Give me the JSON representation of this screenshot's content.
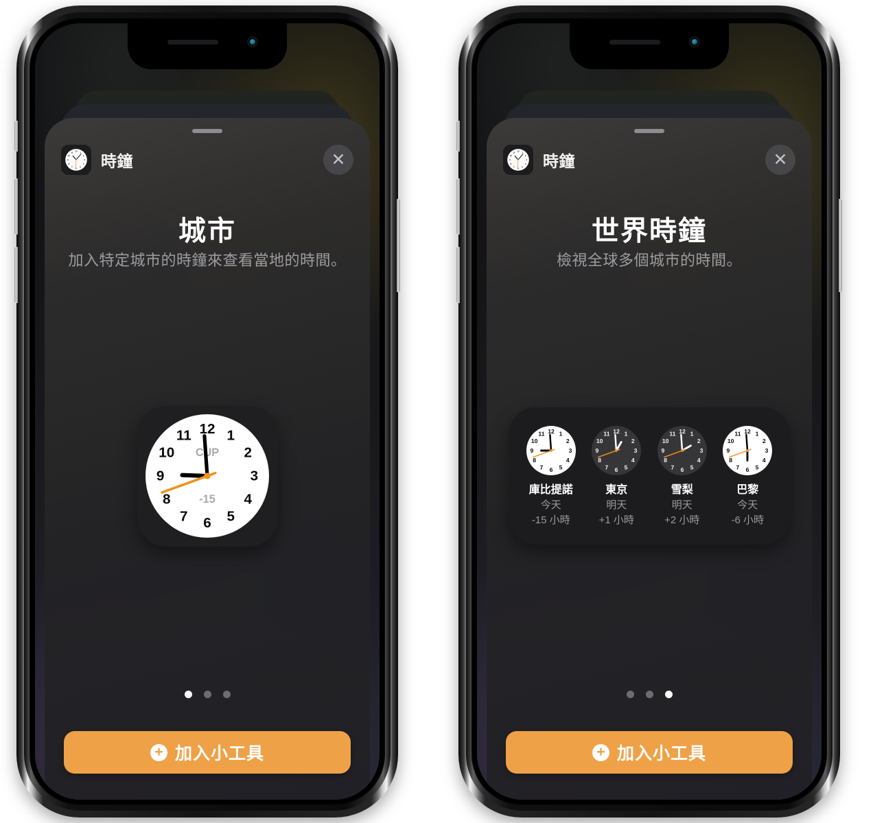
{
  "phones": [
    {
      "id": "left",
      "sheet": {
        "app_icon": "clock-icon",
        "app_name": "時鐘",
        "close_icon": "close-icon",
        "title": "城市",
        "subtitle": "加入特定城市的時鐘來查看當地的時間。"
      },
      "widget": {
        "type": "small-city-clock",
        "clock": {
          "label": "CUP",
          "offset": "-15",
          "theme": "light",
          "hour_deg": 272,
          "minute_deg": 356,
          "second_deg": 250
        }
      },
      "page_dots": {
        "count": 3,
        "active_index": 0
      },
      "add_button": {
        "icon": "plus-circle-icon",
        "label": "加入小工具"
      }
    },
    {
      "id": "right",
      "sheet": {
        "app_icon": "clock-icon",
        "app_name": "時鐘",
        "close_icon": "close-icon",
        "title": "世界時鐘",
        "subtitle": "檢視全球多個城市的時間。"
      },
      "widget": {
        "type": "medium-world-clock",
        "cities": [
          {
            "name": "庫比提諾",
            "day": "今天",
            "offset": "-15 小時",
            "theme": "light",
            "hour_deg": 270,
            "minute_deg": 356,
            "second_deg": 250
          },
          {
            "name": "東京",
            "day": "明天",
            "offset": "+1 小時",
            "theme": "dark",
            "hour_deg": 30,
            "minute_deg": 356,
            "second_deg": 250
          },
          {
            "name": "雪梨",
            "day": "明天",
            "offset": "+2 小時",
            "theme": "dark",
            "hour_deg": 60,
            "minute_deg": 356,
            "second_deg": 250
          },
          {
            "name": "巴黎",
            "day": "今天",
            "offset": "-6 小時",
            "theme": "light",
            "hour_deg": 180,
            "minute_deg": 356,
            "second_deg": 250
          }
        ]
      },
      "page_dots": {
        "count": 3,
        "active_index": 2
      },
      "add_button": {
        "icon": "plus-circle-icon",
        "label": "加入小工具"
      }
    }
  ],
  "colors": {
    "accent_orange": "#efa147",
    "second_hand_orange": "#f0921e",
    "sheet_background": "#2e2d2c",
    "active_dot": "#ffffff",
    "face_light": "#ffffff",
    "face_dark": "#363638"
  },
  "clock_numerals": [
    "12",
    "1",
    "2",
    "3",
    "4",
    "5",
    "6",
    "7",
    "8",
    "9",
    "10",
    "11"
  ]
}
